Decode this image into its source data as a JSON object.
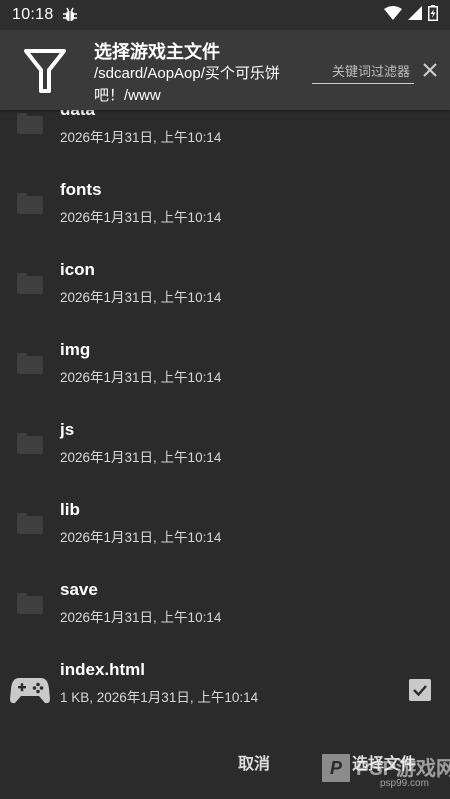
{
  "status_bar": {
    "time": "10:18",
    "icons": [
      "debug-icon",
      "wifi-icon",
      "signal-icon",
      "battery-icon"
    ]
  },
  "header": {
    "icon": "filter-icon",
    "title": "选择游戏主文件",
    "path": "/sdcard/AopAop/买个可乐饼吧！/www",
    "keyword_placeholder": "关键词过滤器",
    "clear_icon": "close-icon"
  },
  "files": [
    {
      "name": "data",
      "meta": "2026年1月31日, 上午10:14",
      "icon": "folder-icon"
    },
    {
      "name": "fonts",
      "meta": "2026年1月31日, 上午10:14",
      "icon": "folder-icon"
    },
    {
      "name": "icon",
      "meta": "2026年1月31日, 上午10:14",
      "icon": "folder-icon"
    },
    {
      "name": "img",
      "meta": "2026年1月31日, 上午10:14",
      "icon": "folder-icon"
    },
    {
      "name": "js",
      "meta": "2026年1月31日, 上午10:14",
      "icon": "folder-icon"
    },
    {
      "name": "lib",
      "meta": "2026年1月31日, 上午10:14",
      "icon": "folder-icon"
    },
    {
      "name": "save",
      "meta": "2026年1月31日, 上午10:14",
      "icon": "folder-icon"
    },
    {
      "name": "index.html",
      "meta": "1 KB, 2026年1月31日, 上午10:14",
      "icon": "gamepad-icon",
      "checked": true
    }
  ],
  "footer": {
    "cancel_label": "取消",
    "confirm_label": "选择文件"
  },
  "watermark": {
    "logo": "P",
    "title": "PSP游戏网",
    "url": "psp99.com"
  },
  "colors": {
    "background": "#2b2b2b",
    "header": "#3a3a3a",
    "folder": "#3f3f3f",
    "checkbox": "#c9c9c9"
  }
}
